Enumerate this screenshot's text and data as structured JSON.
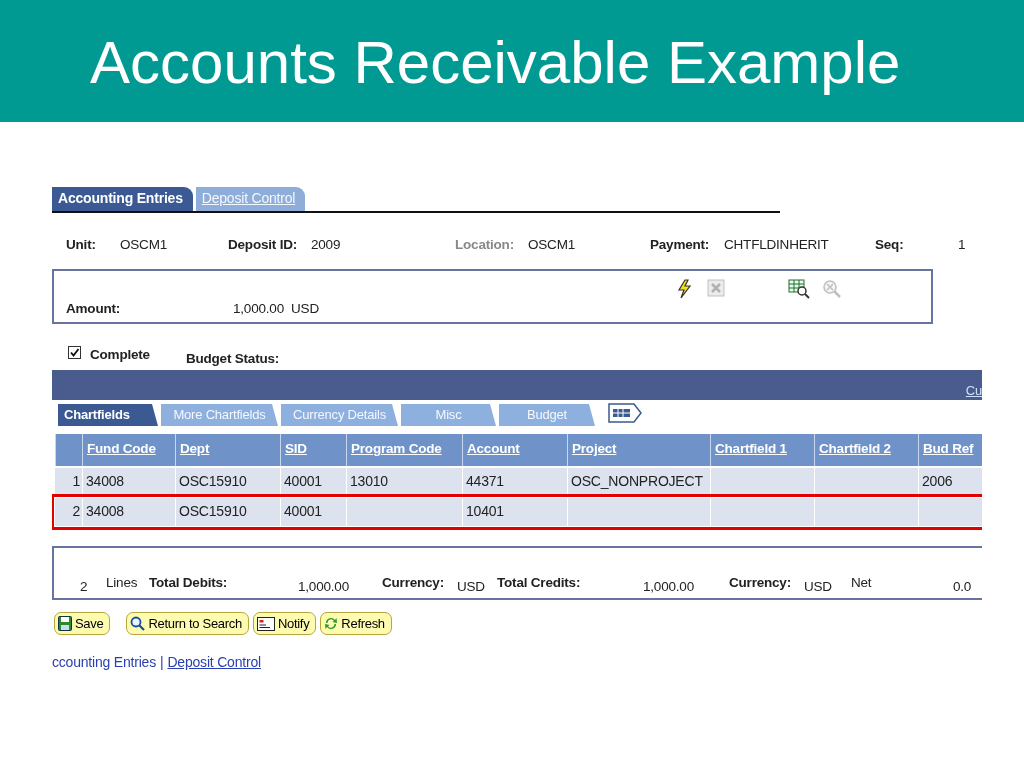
{
  "slide_title": "Accounts Receivable Example",
  "page_tabs": [
    {
      "label": "Accounting Entries",
      "selected": true
    },
    {
      "label": "Deposit Control",
      "selected": false
    }
  ],
  "header_fields": [
    {
      "label": "Unit:",
      "value": "OSCM1",
      "disabled": false
    },
    {
      "label": "Deposit ID:",
      "value": "2009",
      "disabled": false
    },
    {
      "label": "Location:",
      "value": "OSCM1",
      "disabled": true
    },
    {
      "label": "Payment:",
      "value": "CHTFLDINHERIT",
      "disabled": false
    },
    {
      "label": "Seq:",
      "value": "1",
      "disabled": false
    }
  ],
  "amount": {
    "label": "Amount:",
    "value": "1,000.00",
    "currency": "USD"
  },
  "amount_tools": [
    {
      "kind": "lightning",
      "disabled": false
    },
    {
      "kind": "delete",
      "disabled": true
    },
    {
      "kind": "inspect",
      "disabled": false
    },
    {
      "kind": "clear",
      "disabled": true
    }
  ],
  "complete": {
    "label": "Complete",
    "checked": true
  },
  "budget_status": {
    "label": "Budget Status:"
  },
  "grid_link": "Cu",
  "grid_tabs": [
    {
      "label": "Chartfields",
      "selected": true
    },
    {
      "label": "More Chartfields",
      "selected": false
    },
    {
      "label": "Currency Details",
      "selected": false
    },
    {
      "label": "Misc",
      "selected": false
    },
    {
      "label": "Budget",
      "selected": false
    }
  ],
  "grid": {
    "columns": [
      "Fund Code",
      "Dept",
      "SID",
      "Program Code",
      "Account",
      "Project",
      "Chartfield 1",
      "Chartfield 2",
      "Bud Ref"
    ],
    "rows": [
      {
        "number": "1",
        "cells": [
          "34008",
          "OSC15910",
          "40001",
          "13010",
          "44371",
          "OSC_NONPROJECT",
          "",
          "",
          "2006"
        ],
        "highlighted": false
      },
      {
        "number": "2",
        "cells": [
          "34008",
          "OSC15910",
          "40001",
          "",
          "10401",
          "",
          "",
          "",
          ""
        ],
        "highlighted": true
      }
    ]
  },
  "totals": [
    {
      "kind": "value",
      "text": "2"
    },
    {
      "kind": "text",
      "text": "Lines"
    },
    {
      "kind": "label",
      "text": "Total Debits:"
    },
    {
      "kind": "value",
      "text": "1,000.00"
    },
    {
      "kind": "label",
      "text": "Currency:"
    },
    {
      "kind": "value",
      "text": "USD"
    },
    {
      "kind": "label",
      "text": "Total Credits:"
    },
    {
      "kind": "value",
      "text": "1,000.00"
    },
    {
      "kind": "label",
      "text": "Currency:"
    },
    {
      "kind": "value",
      "text": "USD"
    },
    {
      "kind": "text",
      "text": "Net"
    },
    {
      "kind": "value",
      "text": "0.0"
    }
  ],
  "buttons": [
    {
      "label": "Save",
      "kind": "save"
    },
    {
      "label": "Return to Search",
      "kind": "search"
    },
    {
      "label": "Notify",
      "kind": "notify"
    },
    {
      "label": "Refresh",
      "kind": "refresh"
    }
  ],
  "footer_links": [
    {
      "label": "ccounting Entries",
      "selected": true
    },
    {
      "label": "Deposit Control",
      "selected": false
    }
  ],
  "footer_separator": "|"
}
